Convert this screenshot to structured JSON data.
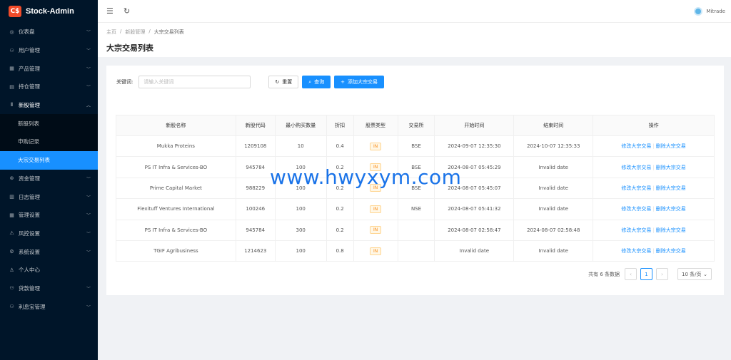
{
  "app": {
    "name": "Stock-Admin",
    "logo_text": "C$"
  },
  "sidebar": {
    "items": [
      {
        "label": "仪表盘",
        "icon": "dashboard-icon",
        "glyph": "◎"
      },
      {
        "label": "用户管理",
        "icon": "users-icon",
        "glyph": "⚇"
      },
      {
        "label": "产品管理",
        "icon": "product-icon",
        "glyph": "▦"
      },
      {
        "label": "持仓管理",
        "icon": "holdings-icon",
        "glyph": "▤"
      },
      {
        "label": "新股管理",
        "icon": "ipo-icon",
        "glyph": "⫴"
      }
    ],
    "sub": [
      {
        "label": "新股列表"
      },
      {
        "label": "申购记录"
      },
      {
        "label": "大宗交易列表"
      }
    ],
    "items2": [
      {
        "label": "资金管理",
        "icon": "funds-icon",
        "glyph": "⊛"
      },
      {
        "label": "日志管理",
        "icon": "log-icon",
        "glyph": "▥"
      },
      {
        "label": "管理设置",
        "icon": "admin-settings-icon",
        "glyph": "▦"
      },
      {
        "label": "风控设置",
        "icon": "risk-warning-icon",
        "glyph": "⚠"
      },
      {
        "label": "系统设置",
        "icon": "gear-icon",
        "glyph": "⚙"
      },
      {
        "label": "个人中心",
        "icon": "user-icon",
        "glyph": "♙"
      },
      {
        "label": "贷款管理",
        "icon": "loan-icon",
        "glyph": "⚇"
      },
      {
        "label": "利息宝管理",
        "icon": "interest-icon",
        "glyph": "⚇"
      }
    ]
  },
  "header": {
    "user": "Mitrade"
  },
  "breadcrumb": [
    "主页",
    "新股管理",
    "大宗交易列表"
  ],
  "page_title": "大宗交易列表",
  "filter": {
    "label": "关键词:",
    "placeholder": "请输入关键词",
    "reset": "重置",
    "search": "查询",
    "add": "添加大宗交易"
  },
  "table": {
    "headers": [
      "新股名称",
      "新股代码",
      "最小购买数量",
      "折扣",
      "股票类型",
      "交易所",
      "开始时间",
      "结束时间",
      "操作"
    ],
    "rows": [
      [
        "Mukka Proteins",
        "1209108",
        "10",
        "0.4",
        "IN",
        "BSE",
        "2024-09-07 12:35:30",
        "2024-10-07 12:35:33"
      ],
      [
        "PS IT Infra & Services-BO",
        "945784",
        "100",
        "0.2",
        "IN",
        "BSE",
        "2024-08-07 05:45:29",
        "Invalid date"
      ],
      [
        "Prime Capital Market",
        "988229",
        "100",
        "0.2",
        "IN",
        "BSE",
        "2024-08-07 05:45:07",
        "Invalid date"
      ],
      [
        "Flexituff Ventures International",
        "100246",
        "100",
        "0.2",
        "IN",
        "NSE",
        "2024-08-07 05:41:32",
        "Invalid date"
      ],
      [
        "PS IT Infra & Services-BO",
        "945784",
        "300",
        "0.2",
        "IN",
        "",
        "2024-08-07 02:58:47",
        "2024-08-07 02:58:48"
      ],
      [
        "TGIF Agribusiness",
        "1214623",
        "100",
        "0.8",
        "IN",
        "",
        "Invalid date",
        "Invalid date"
      ]
    ],
    "edit_label": "修改大宗交易",
    "delete_label": "删除大宗交易"
  },
  "pagination": {
    "total_text": "共有 6 条数据",
    "current": "1",
    "size": "10 条/页"
  },
  "watermark": "www.hwyxym.com"
}
